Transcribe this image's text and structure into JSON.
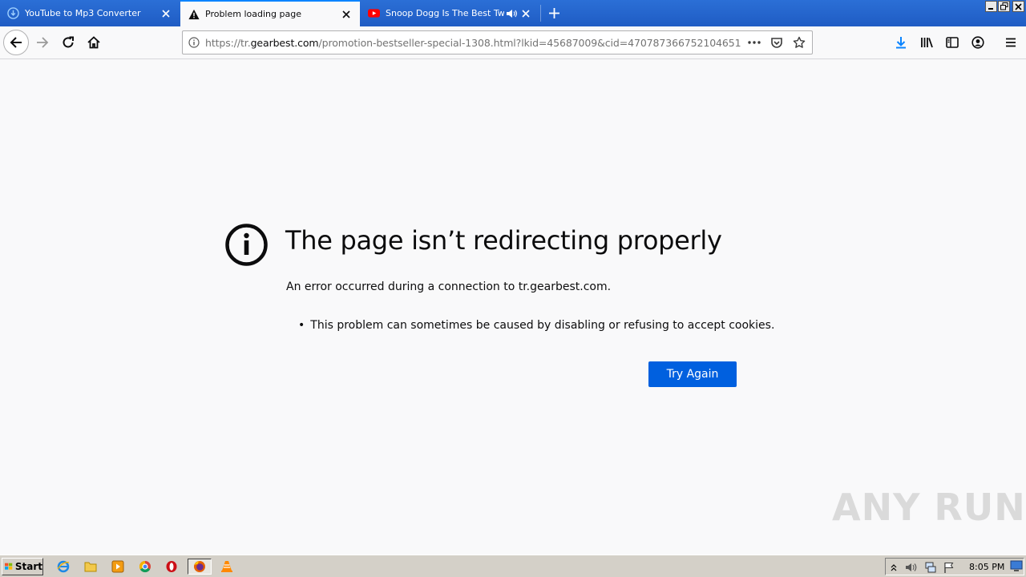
{
  "tabs": [
    {
      "title": "YouTube to Mp3 Converter",
      "icon": "cloud-download-icon",
      "active": false
    },
    {
      "title": "Problem loading page",
      "icon": "warning-icon",
      "active": true
    },
    {
      "title": "Snoop Dogg Is The Best Twitch",
      "icon": "youtube-icon",
      "active": false,
      "audio": true
    }
  ],
  "navbar": {
    "url_prefix": "https://tr.",
    "url_host": "gearbest.com",
    "url_path": "/promotion-bestseller-special-1308.html?lkid=45687009&cid=470787366752104651"
  },
  "error": {
    "title": "The page isn’t redirecting properly",
    "description": "An error occurred during a connection to tr.gearbest.com.",
    "items": [
      "This problem can sometimes be caused by disabling or refusing to accept cookies."
    ],
    "button_label": "Try Again"
  },
  "watermark": "ANY RUN",
  "taskbar": {
    "start_label": "Start",
    "clock": "8:05 PM"
  },
  "colors": {
    "tabbar": "#1f5cc4",
    "accent": "#0060df",
    "download": "#0a84ff",
    "youtube": "#ff0000"
  }
}
